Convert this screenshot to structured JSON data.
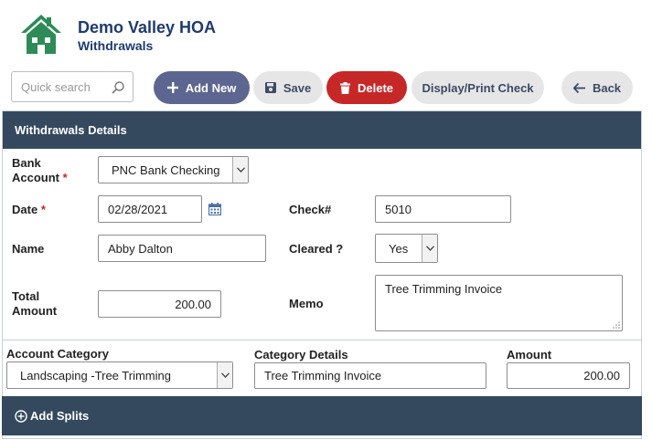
{
  "header": {
    "org_name": "Demo Valley HOA",
    "page_subtitle": "Withdrawals",
    "logo_icon": "house-icon",
    "brand_color": "#2e8b57"
  },
  "toolbar": {
    "search_placeholder": "Quick search",
    "search_value": "",
    "add_new_label": "Add New",
    "save_label": "Save",
    "delete_label": "Delete",
    "print_label": "Display/Print Check",
    "back_label": "Back"
  },
  "details": {
    "title": "Withdrawals Details",
    "bank_account_label_1": "Bank",
    "bank_account_label_2": "Account",
    "bank_account_value": "PNC Bank Checking",
    "date_label": "Date",
    "date_value": "02/28/2021",
    "check_label": "Check#",
    "check_value": "5010",
    "name_label": "Name",
    "name_value": "Abby Dalton",
    "cleared_label": "Cleared ?",
    "cleared_value": "Yes",
    "total_label_1": "Total",
    "total_label_2": "Amount",
    "total_value": "200.00",
    "memo_label": "Memo",
    "memo_value": "Tree Trimming Invoice",
    "required_mark": "*"
  },
  "split": {
    "category_label": "Account Category",
    "category_value": "Landscaping -Tree Trimming",
    "details_label": "Category Details",
    "details_value": "Tree Trimming Invoice",
    "amount_label": "Amount",
    "amount_value": "200.00",
    "add_splits_label": "Add Splits"
  },
  "colors": {
    "primary": "#5d6690",
    "danger": "#c62828",
    "panel_header": "#34495e",
    "title_text": "#1f3b6e"
  }
}
